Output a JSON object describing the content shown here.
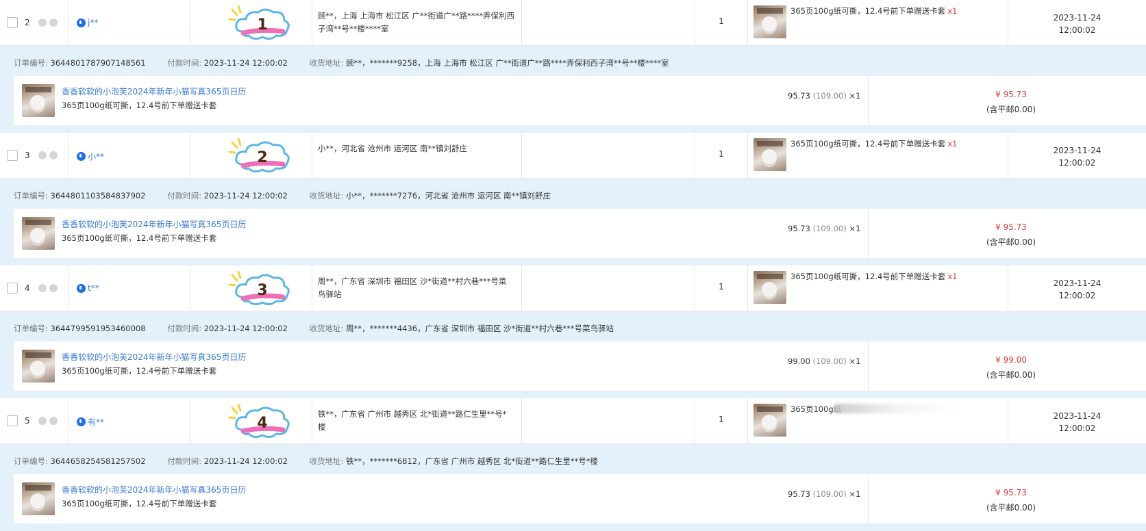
{
  "orders": [
    {
      "index": "2",
      "buyer": "j**",
      "badge_number": "1",
      "address_lines": [
        "顾**，上海 上海市 松江区 广**街道广**路****弄保利西",
        "子湾**号**楼****室"
      ],
      "quantity": "1",
      "product_spec": "365页100g纸可撕，12.4号前下单赠送卡套",
      "product_qty": "x1",
      "date": "2023-11-24",
      "time": "12:00:02",
      "order_no_label": "订单编号:",
      "order_no": "3644801787907148561",
      "pay_time_label": "付款时间:",
      "pay_time": "2023-11-24 12:00:02",
      "recv_label": "收货地址:",
      "recv": "顾**，*******9258，上海 上海市 松江区 广**街道广**路****弄保利西子湾**号**楼****室",
      "item_title": "香香软软的小泡芙2024年新年小猫写真365页日历",
      "item_sub": "365页100g纸可撕，12.4号前下单赠送卡套",
      "unit_price": "95.73",
      "orig_price": "(109.00)",
      "item_qty": "×1",
      "paid": "¥ 95.73",
      "shipping_note": "(含平邮0.00)"
    },
    {
      "index": "3",
      "buyer": "小**",
      "badge_number": "2",
      "address_lines": [
        "小**，河北省 沧州市 运河区 南**镇刘舒庄"
      ],
      "quantity": "1",
      "product_spec": "365页100g纸可撕，12.4号前下单赠送卡套",
      "product_qty": "x1",
      "date": "2023-11-24",
      "time": "12:00:02",
      "order_no_label": "订单编号:",
      "order_no": "3644801103584837902",
      "pay_time_label": "付款时间:",
      "pay_time": "2023-11-24 12:00:02",
      "recv_label": "收货地址:",
      "recv": "小**，*******7276，河北省 沧州市 运河区 南**镇刘舒庄",
      "item_title": "香香软软的小泡芙2024年新年小猫写真365页日历",
      "item_sub": "365页100g纸可撕，12.4号前下单赠送卡套",
      "unit_price": "95.73",
      "orig_price": "(109.00)",
      "item_qty": "×1",
      "paid": "¥ 95.73",
      "shipping_note": "(含平邮0.00)"
    },
    {
      "index": "4",
      "buyer": "t**",
      "badge_number": "3",
      "address_lines": [
        "周**，广东省 深圳市 福田区 沙*街道**村六巷***号菜",
        "鸟驿站"
      ],
      "quantity": "1",
      "product_spec": "365页100g纸可撕，12.4号前下单赠送卡套",
      "product_qty": "x1",
      "date": "2023-11-24",
      "time": "12:00:02",
      "order_no_label": "订单编号:",
      "order_no": "3644799591953460008",
      "pay_time_label": "付款时间:",
      "pay_time": "2023-11-24 12:00:02",
      "recv_label": "收货地址:",
      "recv": "周**，*******4436，广东省 深圳市 福田区 沙*街道**村六巷***号菜鸟驿站",
      "item_title": "香香软软的小泡芙2024年新年小猫写真365页日历",
      "item_sub": "365页100g纸可撕，12.4号前下单赠送卡套",
      "unit_price": "99.00",
      "orig_price": "(109.00)",
      "item_qty": "×1",
      "paid": "¥ 99.00",
      "shipping_note": "(含平邮0.00)"
    },
    {
      "index": "5",
      "buyer": "有**",
      "badge_number": "4",
      "address_lines": [
        "铁**，广东省 广州市 越秀区 北*街道**路仁生里**号*",
        "楼"
      ],
      "quantity": "1",
      "product_spec": "365页100g纸",
      "product_qty": "",
      "date": "2023-11-24",
      "time": "12:00:02",
      "order_no_label": "订单编号:",
      "order_no": "3644658254581257502",
      "pay_time_label": "付款时间:",
      "pay_time": "2023-11-24 12:00:02",
      "recv_label": "收货地址:",
      "recv": "铁**，*******6812，广东省 广州市 越秀区 北*街道**路仁生里**号*楼",
      "item_title": "香香软软的小泡芙2024年新年小猫写真365页日历",
      "item_sub": "365页100g纸可撕，12.4号前下单赠送卡套",
      "unit_price": "95.73",
      "orig_price": "(109.00)",
      "item_qty": "×1",
      "paid": "¥ 95.73",
      "shipping_note": "(含平邮0.00)"
    }
  ],
  "colors": {
    "accent_blue": "#3a7bd5",
    "price_red": "#e23b3b",
    "band_bg": "#e4f1fb",
    "cloud_blue": "#5bb6e6",
    "cloud_pink": "#ee6fb8"
  },
  "icons": {
    "checkbox": "checkbox",
    "buyer": "wangwang-chat-icon",
    "badge": "cloud-number-sticker"
  }
}
